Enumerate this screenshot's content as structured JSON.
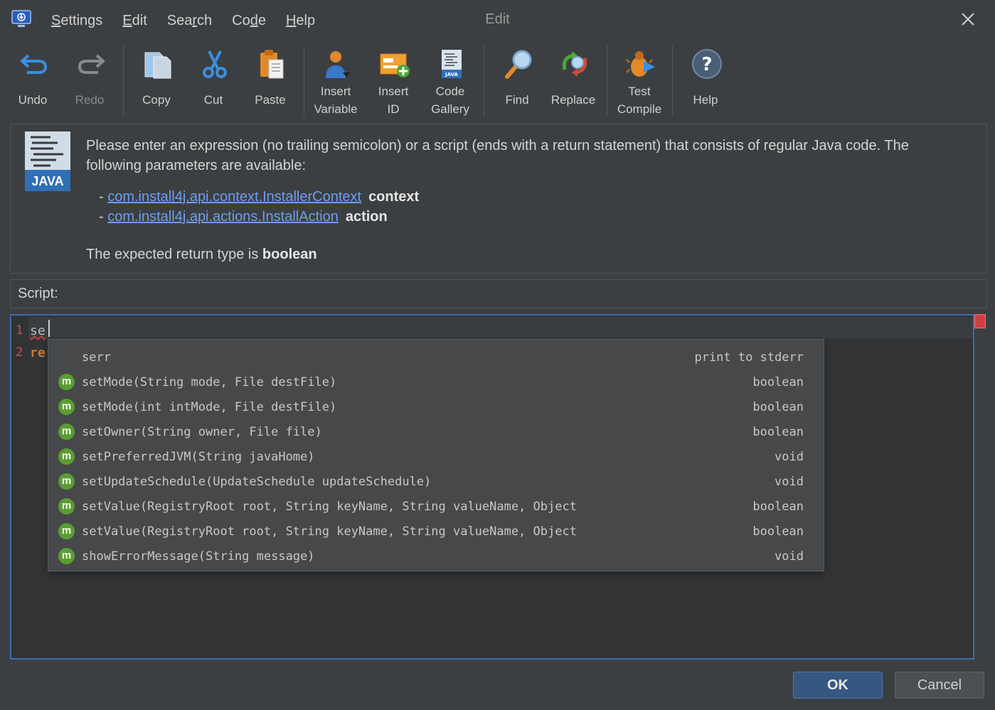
{
  "window": {
    "title": "Edit"
  },
  "menu": [
    {
      "label": "Settings",
      "mnemonic": "S",
      "rest": "ettings"
    },
    {
      "label": "Edit",
      "mnemonic": "E",
      "rest": "dit"
    },
    {
      "label": "Search",
      "pre": "Sea",
      "mnemonic": "r",
      "rest": "ch"
    },
    {
      "label": "Code",
      "pre": "Co",
      "mnemonic": "d",
      "rest": "e"
    },
    {
      "label": "Help",
      "mnemonic": "H",
      "rest": "elp"
    }
  ],
  "toolbar": {
    "undo": "Undo",
    "redo": "Redo",
    "copy": "Copy",
    "cut": "Cut",
    "paste": "Paste",
    "insert_variable_1": "Insert",
    "insert_variable_2": "Variable",
    "insert_id_1": "Insert",
    "insert_id_2": "ID",
    "code_gallery_1": "Code",
    "code_gallery_2": "Gallery",
    "find": "Find",
    "replace": "Replace",
    "test_compile_1": "Test",
    "test_compile_2": "Compile",
    "help": "Help"
  },
  "info": {
    "logo_text": "JAVA",
    "description": "Please enter an expression (no trailing semicolon) or a script (ends with a return statement) that consists of regular Java code. The following parameters are available:",
    "params": [
      {
        "dash": "- ",
        "type": "com.install4j.api.context.InstallerContext",
        "name": "context"
      },
      {
        "dash": "- ",
        "type": "com.install4j.api.actions.InstallAction",
        "name": "action"
      }
    ],
    "return_prefix": "The expected return type is ",
    "return_type": "boolean"
  },
  "script_label": "Script:",
  "editor": {
    "lines": [
      {
        "number": "1",
        "text": "se"
      },
      {
        "number": "2",
        "text": "re"
      }
    ]
  },
  "completion": [
    {
      "icon": "",
      "name": "serr",
      "type": "print to stderr"
    },
    {
      "icon": "m",
      "name": "setMode(String mode, File destFile)",
      "type": "boolean"
    },
    {
      "icon": "m",
      "name": "setMode(int intMode, File destFile)",
      "type": "boolean"
    },
    {
      "icon": "m",
      "name": "setOwner(String owner, File file)",
      "type": "boolean"
    },
    {
      "icon": "m",
      "name": "setPreferredJVM(String javaHome)",
      "type": "void"
    },
    {
      "icon": "m",
      "name": "setUpdateSchedule(UpdateSchedule updateSchedule)",
      "type": "void"
    },
    {
      "icon": "m",
      "name": "setValue(RegistryRoot root, String keyName, String valueName, Object",
      "type": "boolean"
    },
    {
      "icon": "m",
      "name": "setValue(RegistryRoot root, String keyName, String valueName, Object",
      "type": "boolean"
    },
    {
      "icon": "m",
      "name": "showErrorMessage(String message)",
      "type": "void"
    }
  ],
  "buttons": {
    "ok": "OK",
    "cancel": "Cancel"
  }
}
